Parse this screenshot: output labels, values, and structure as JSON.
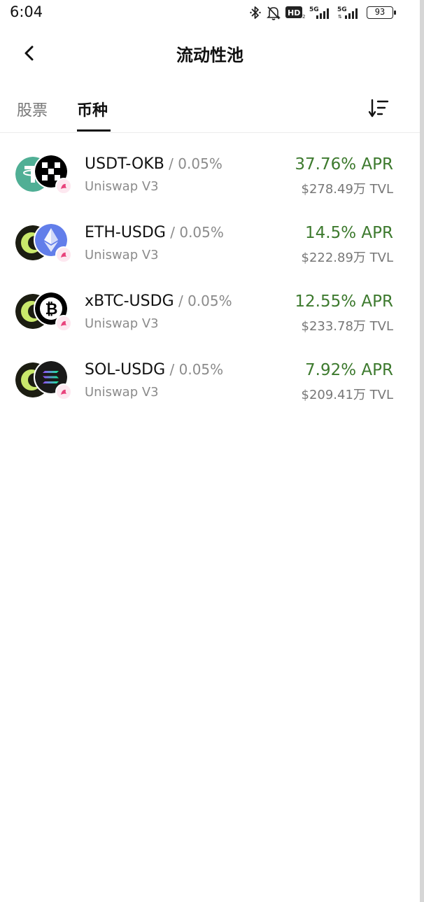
{
  "status_bar": {
    "time": "6:04",
    "battery": "93",
    "hd_label": "HD",
    "network_1": "5G",
    "network_2": "5G"
  },
  "header": {
    "title": "流动性池"
  },
  "tabs": [
    {
      "label": "股票",
      "active": false
    },
    {
      "label": "币种",
      "active": true
    }
  ],
  "colors": {
    "apr_green": "#3d7a2e",
    "muted_text": "#8b8b8b"
  },
  "pools": [
    {
      "pair": "USDT-OKB",
      "fee": " / 0.05%",
      "protocol": "Uniswap V3",
      "apr": "37.76% APR",
      "tvl": "$278.49万 TVL",
      "coin_a_icon": "usdt-icon",
      "coin_b_icon": "okb-icon"
    },
    {
      "pair": "ETH-USDG",
      "fee": " / 0.05%",
      "protocol": "Uniswap V3",
      "apr": "14.5% APR",
      "tvl": "$222.89万 TVL",
      "coin_a_icon": "usdg-icon",
      "coin_b_icon": "eth-icon"
    },
    {
      "pair": "xBTC-USDG",
      "fee": " / 0.05%",
      "protocol": "Uniswap V3",
      "apr": "12.55% APR",
      "tvl": "$233.78万 TVL",
      "coin_a_icon": "usdg-icon",
      "coin_b_icon": "xbtc-icon"
    },
    {
      "pair": "SOL-USDG",
      "fee": " / 0.05%",
      "protocol": "Uniswap V3",
      "apr": "7.92% APR",
      "tvl": "$209.41万 TVL",
      "coin_a_icon": "usdg-icon",
      "coin_b_icon": "sol-icon"
    }
  ]
}
